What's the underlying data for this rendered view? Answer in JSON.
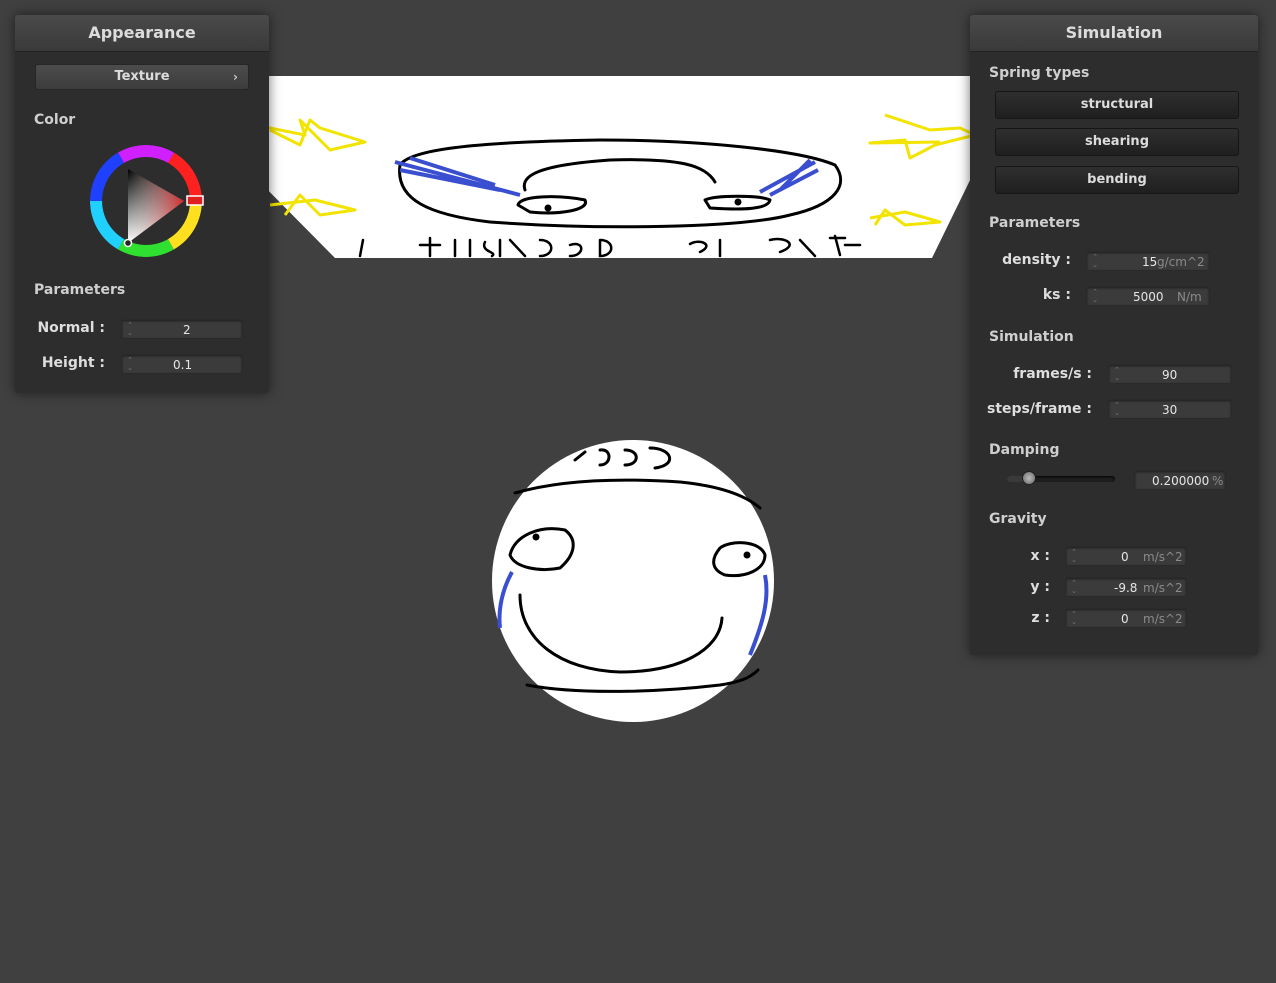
{
  "appearance_panel": {
    "title": "Appearance",
    "texture_button": "Texture",
    "color_label": "Color",
    "parameters_label": "Parameters",
    "normal_label": "Normal :",
    "normal_value": "2",
    "height_label": "Height :",
    "height_value": "0.1"
  },
  "simulation_panel": {
    "title": "Simulation",
    "spring_types_label": "Spring types",
    "spring_buttons": [
      "structural",
      "shearing",
      "bending"
    ],
    "parameters_label": "Parameters",
    "density_label": "density :",
    "density_value": "15",
    "density_unit": "g/cm^2",
    "ks_label": "ks :",
    "ks_value": "5000",
    "ks_unit": "N/m",
    "simulation_label": "Simulation",
    "fps_label": "frames/s :",
    "fps_value": "90",
    "steps_label": "steps/frame :",
    "steps_value": "30",
    "damping_label": "Damping",
    "damping_value": "0.200000",
    "damping_unit": "%",
    "damping_fraction": 0.2,
    "gravity_label": "Gravity",
    "gx_label": "x :",
    "gx_value": "0",
    "gy_label": "y :",
    "gy_value": "-9.8",
    "gz_label": "z :",
    "gz_value": "0",
    "gravity_unit": "m/s^2"
  },
  "colors": {
    "background": "#404040",
    "panel": "#2d2d2d",
    "selected_color": "#e02020",
    "doodle_ink": "#000000",
    "doodle_blue": "#3a4fd0",
    "doodle_stars": "#f5e600"
  }
}
